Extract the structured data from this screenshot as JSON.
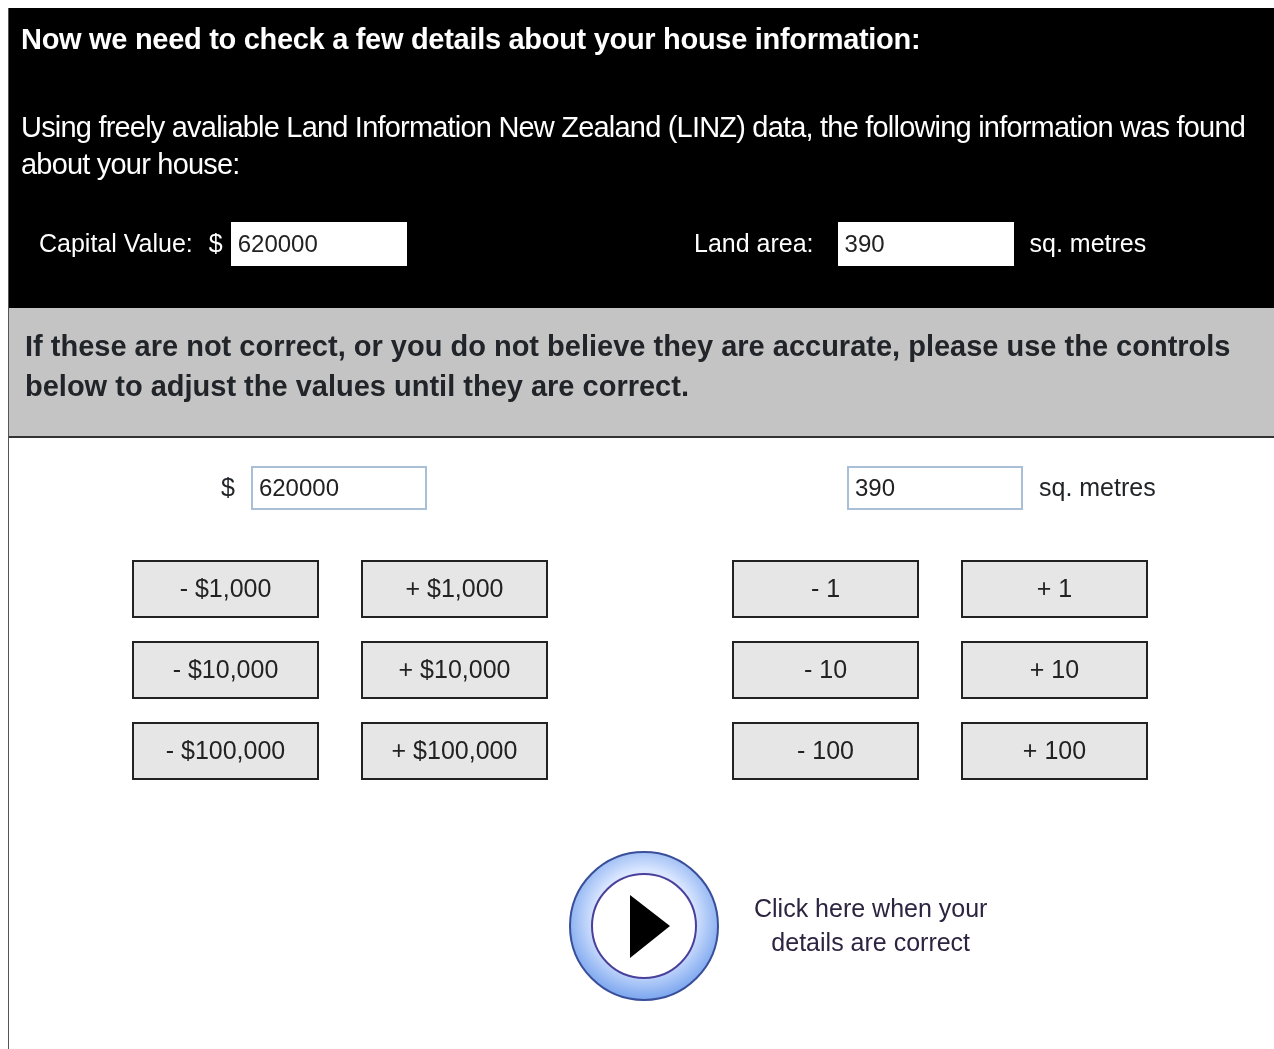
{
  "heading": "Now we need to check a few details about your house information:",
  "intro": "Using freely avaliable Land Information New Zealand (LINZ) data, the following information was found about your house:",
  "found": {
    "capital_label": "Capital Value:",
    "currency": "$",
    "capital_value": "620000",
    "land_label": "Land area:",
    "land_value": "390",
    "unit": "sq. metres"
  },
  "notice": "If these are not correct, or you do not believe they are accurate, please use the controls below to adjust the values until they are correct.",
  "adjust": {
    "currency": "$",
    "capital_value": "620000",
    "land_value": "390",
    "unit": "sq. metres",
    "capital_buttons": [
      "- $1,000",
      "+ $1,000",
      "- $10,000",
      "+ $10,000",
      "- $100,000",
      "+ $100,000"
    ],
    "land_buttons": [
      "- 1",
      "+ 1",
      "- 10",
      "+ 10",
      "- 100",
      "+ 100"
    ]
  },
  "continue": {
    "label": "Click here when your\ndetails are correct"
  }
}
